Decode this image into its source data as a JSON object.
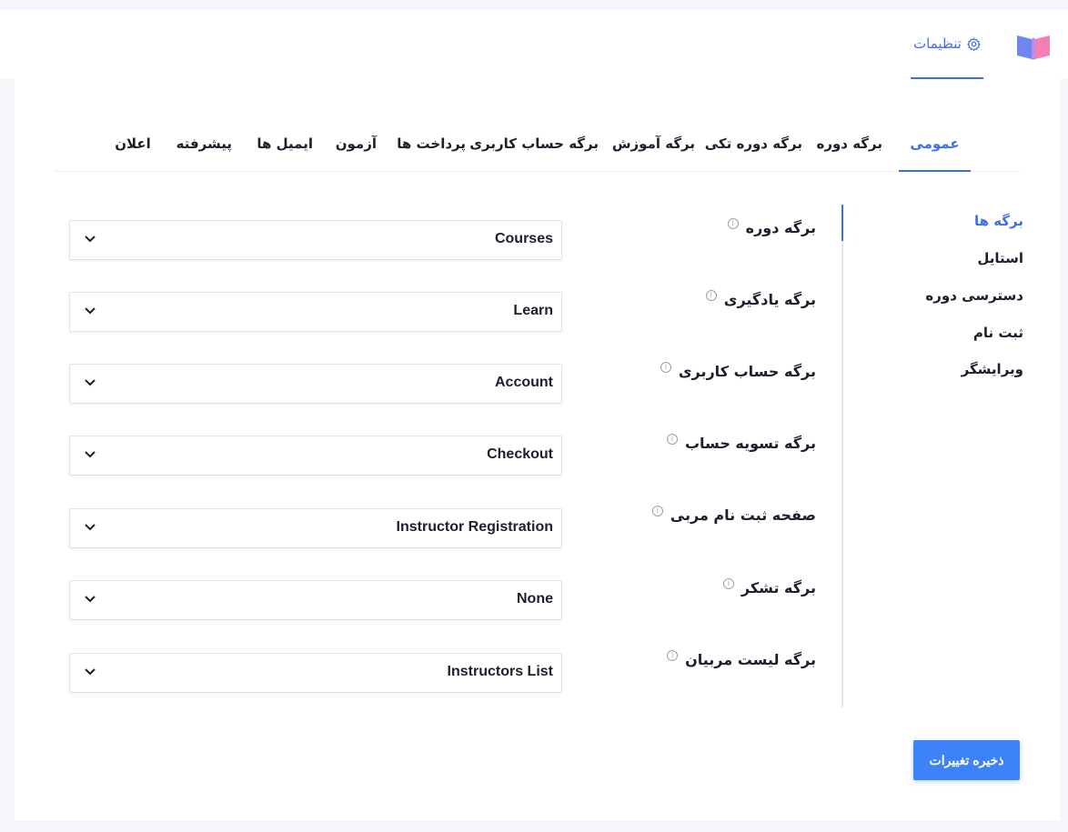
{
  "header": {
    "tab_label": "تنظیمات",
    "accent": "#3e6fe8",
    "logo_icon": "book-icon",
    "tab_icon": "gear-icon"
  },
  "tabs": [
    {
      "label": "عمومی",
      "active": true
    },
    {
      "label": "برگه دوره"
    },
    {
      "label": "برگه دوره تکی"
    },
    {
      "label": "برگه آموزش"
    },
    {
      "label": "برگه حساب کاربری"
    },
    {
      "label": "پرداخت ها"
    },
    {
      "label": "آزمون"
    },
    {
      "label": "ایمیل ها"
    },
    {
      "label": "پیشرفته"
    },
    {
      "label": "اعلان"
    }
  ],
  "side_nav": [
    {
      "label": "برگه ها",
      "active": true
    },
    {
      "label": "استایل"
    },
    {
      "label": "دسترسی دوره"
    },
    {
      "label": "ثبت نام"
    },
    {
      "label": "ویرایشگر"
    }
  ],
  "fields": [
    {
      "label": "برگه دوره",
      "value": "Courses"
    },
    {
      "label": "برگه یادگیری",
      "value": "Learn"
    },
    {
      "label": "برگه حساب کاربری",
      "value": "Account"
    },
    {
      "label": "برگه تسویه حساب",
      "value": "Checkout"
    },
    {
      "label": "صفحه ثبت نام مربی",
      "value": "Instructor Registration"
    },
    {
      "label": "برگه تشکر",
      "value": "None"
    },
    {
      "label": "برگه لیست مربیان",
      "value": "Instructors List"
    }
  ],
  "save_button": "ذخیره تغییرات",
  "info_glyph": "i"
}
